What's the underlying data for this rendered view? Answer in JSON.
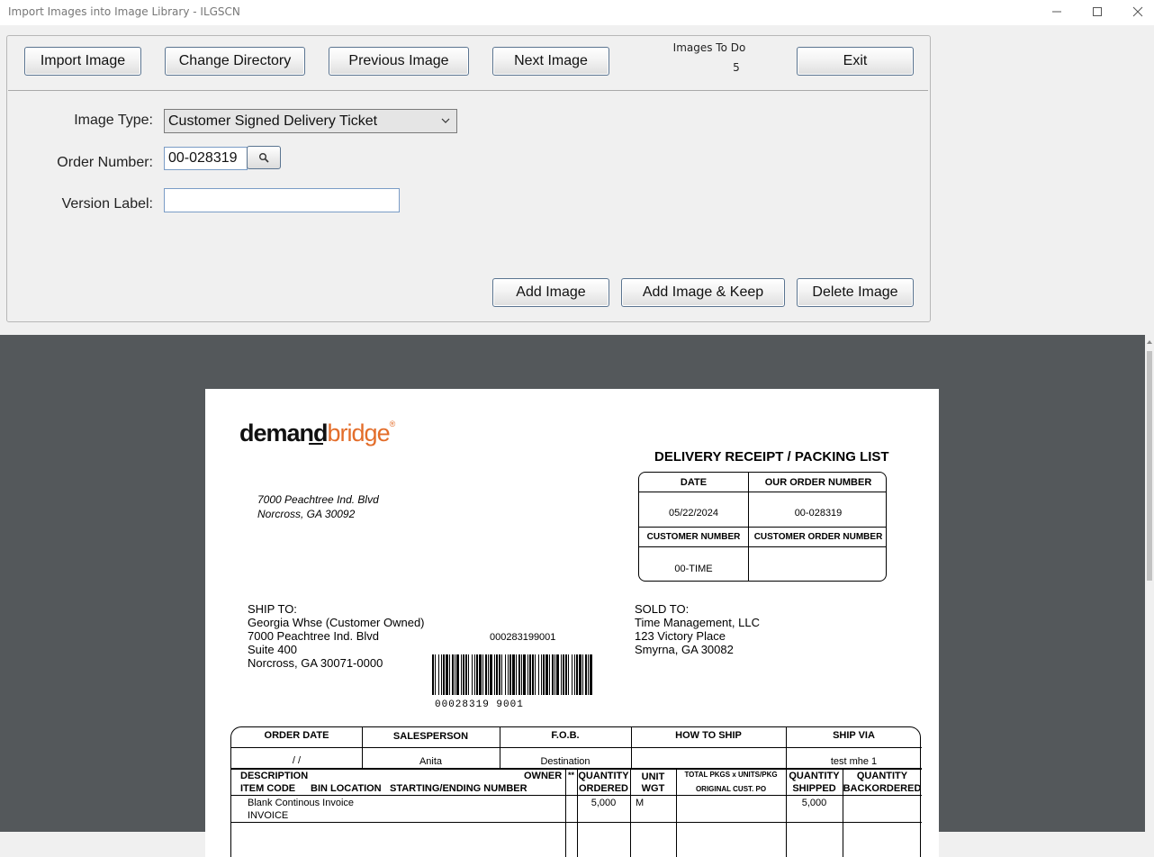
{
  "window": {
    "title": "Import Images into Image Library - ILGSCN",
    "controls": [
      "minimize-icon",
      "maximize-icon",
      "close-icon"
    ]
  },
  "toolbar": {
    "import_image": "Import Image",
    "change_directory": "Change Directory",
    "previous_image": "Previous Image",
    "next_image": "Next Image",
    "images_to_do_label": "Images To Do",
    "images_to_do_count": "5",
    "exit": "Exit"
  },
  "form": {
    "image_type_label": "Image Type:",
    "image_type_value": "Customer Signed Delivery Ticket",
    "order_number_label": "Order Number:",
    "order_number_value": "00-028319",
    "version_label_label": "Version Label:",
    "version_label_value": ""
  },
  "actions": {
    "add_image": "Add Image",
    "add_image_keep": "Add Image & Keep",
    "delete_image": "Delete Image"
  },
  "document": {
    "logo_part1": "demand",
    "logo_part2": "bridge",
    "logo_reg": "®",
    "address_line1": "7000 Peachtree Ind. Blvd",
    "address_line2": "Norcross, GA 30092",
    "title": "DELIVERY RECEIPT / PACKING LIST",
    "header_box": {
      "date_label": "DATE",
      "order_number_label": "OUR ORDER NUMBER",
      "date": "05/22/2024",
      "order_number": "00-028319",
      "customer_number_label": "CUSTOMER NUMBER",
      "customer_order_label": "CUSTOMER ORDER NUMBER",
      "customer_number": "00-TIME",
      "customer_order": ""
    },
    "ship_to": {
      "label": "SHIP TO:",
      "line1": "Georgia Whse (Customer Owned)",
      "line2": "7000 Peachtree Ind. Blvd",
      "line3": "Suite 400",
      "line4": "Norcross, GA 30071-0000"
    },
    "sold_to": {
      "label": "SOLD TO:",
      "line1": "Time Management, LLC",
      "line2": "123 Victory Place",
      "line3": "Smyrna, GA 30082"
    },
    "barcode_number": "000283199001",
    "barcode_text": "00028319  9001",
    "table": {
      "order_date_label": "ORDER DATE",
      "salesperson_label": "SALESPERSON",
      "fob_label": "F.O.B.",
      "how_to_ship_label": "HOW TO SHIP",
      "ship_via_label": "SHIP VIA",
      "order_date": "/  /",
      "salesperson": "Anita",
      "fob": "Destination",
      "how_to_ship": "",
      "ship_via": "test mhe 1",
      "description_label": "DESCRIPTION",
      "item_code_label": "ITEM CODE",
      "bin_location_label": "BIN LOCATION",
      "starting_ending_label": "STARTING/ENDING NUMBER",
      "owner_label": "OWNER",
      "star_label": "**",
      "quantity_label": "QUANTITY",
      "ordered_label": "ORDERED",
      "unit_label": "UNIT",
      "wgt_label": "WGT",
      "total_pkgs_label": "TOTAL PKGS x UNITS/PKG",
      "original_po_label": "ORIGINAL CUST. PO",
      "quantity_shipped_label1": "QUANTITY",
      "quantity_shipped_label2": "SHIPPED",
      "quantity_backordered_label1": "QUANTITY",
      "quantity_backordered_label2": "BACKORDERED",
      "row1_description": "Blank Continous Invoice",
      "row1_item": "INVOICE",
      "row1_ordered": "5,000",
      "row1_unit": "M",
      "row1_shipped": "5,000"
    }
  }
}
